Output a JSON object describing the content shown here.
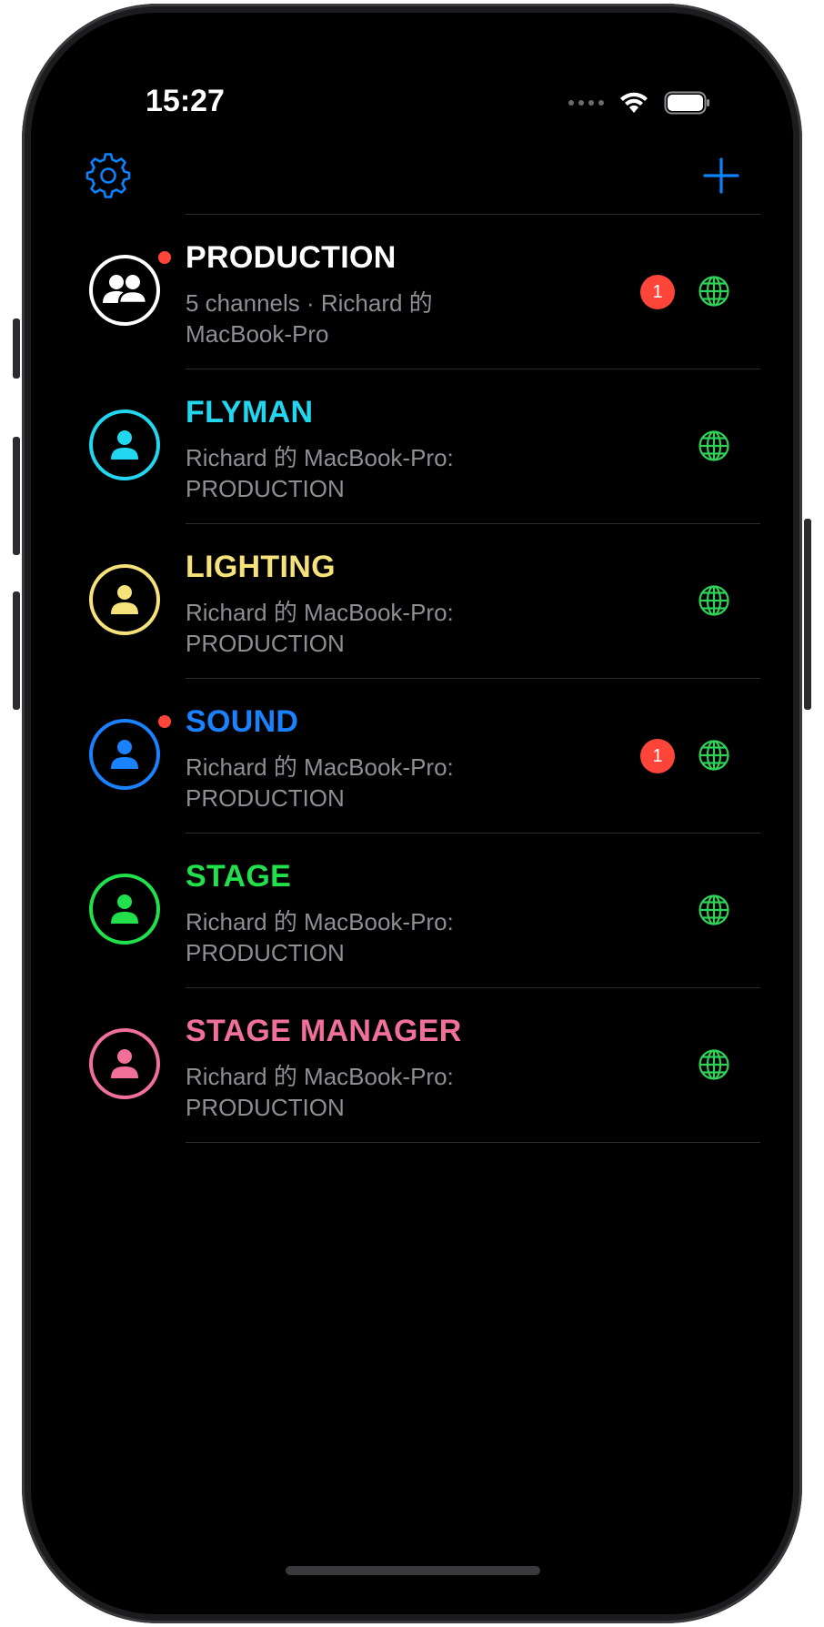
{
  "status_bar": {
    "time": "15:27"
  },
  "nav": {
    "settings_icon": "gear-icon",
    "add_icon": "plus-icon",
    "accent": "#0a84ff"
  },
  "channels": [
    {
      "title": "PRODUCTION",
      "subtitle": "5 channels · Richard 的 MacBook-Pro",
      "color": "#ffffff",
      "icon": "group-icon",
      "unread_dot": true,
      "badge": "1"
    },
    {
      "title": "FLYMAN",
      "subtitle": "Richard 的 MacBook-Pro: PRODUCTION",
      "color": "#23d6f0",
      "icon": "person-icon",
      "unread_dot": false,
      "badge": ""
    },
    {
      "title": "LIGHTING",
      "subtitle": "Richard 的 MacBook-Pro: PRODUCTION",
      "color": "#f6e27a",
      "icon": "person-icon",
      "unread_dot": false,
      "badge": ""
    },
    {
      "title": "SOUND",
      "subtitle": "Richard 的 MacBook-Pro: PRODUCTION",
      "color": "#1a82ff",
      "icon": "person-icon",
      "unread_dot": true,
      "badge": "1"
    },
    {
      "title": "STAGE",
      "subtitle": "Richard 的 MacBook-Pro: PRODUCTION",
      "color": "#21e04b",
      "icon": "person-icon",
      "unread_dot": false,
      "badge": ""
    },
    {
      "title": "STAGE MANAGER",
      "subtitle": "Richard 的 MacBook-Pro: PRODUCTION",
      "color": "#f0709a",
      "icon": "person-icon",
      "unread_dot": false,
      "badge": ""
    }
  ],
  "globe_icon": "globe-icon",
  "globe_color": "#30d158",
  "badge_color": "#ff453a"
}
